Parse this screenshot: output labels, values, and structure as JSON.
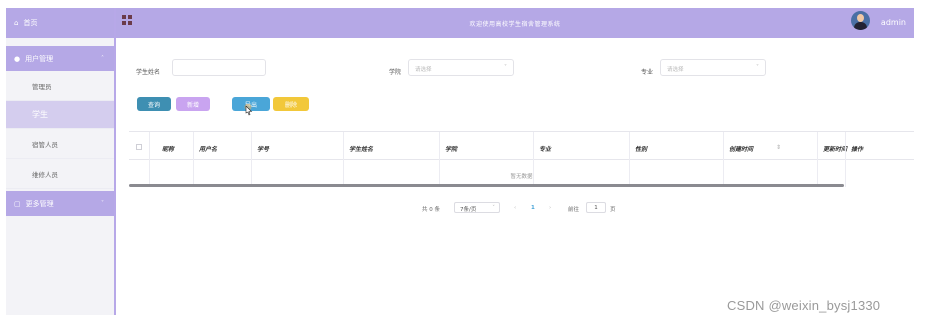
{
  "sidebar": {
    "home": "首页",
    "groups": [
      {
        "label": "用户管理",
        "items": [
          {
            "label": "管理员"
          },
          {
            "label": "学生"
          },
          {
            "label": "宿管人员"
          },
          {
            "label": "维修人员"
          }
        ]
      },
      {
        "label": "更多管理"
      }
    ]
  },
  "header": {
    "title": "欢迎使用高校学生宿舍管理系统",
    "user": "admin"
  },
  "search": {
    "student_name_label": "学生姓名",
    "college_label": "学院",
    "college_placeholder": "请选择",
    "major_label": "专业",
    "major_placeholder": "请选择"
  },
  "buttons": {
    "query": "查询",
    "add": "新增",
    "export": "导出",
    "delete": "删除"
  },
  "table": {
    "columns": [
      "昵称",
      "用户名",
      "学号",
      "学生姓名",
      "学院",
      "专业",
      "性别",
      "创建时间",
      "更新时间",
      "操作"
    ],
    "empty_text": "暂无数据"
  },
  "pagination": {
    "total": "共 0 条",
    "page_size": "7条/页",
    "current_page": "1",
    "goto_label": "前往",
    "goto_value": "1",
    "page_suffix": "页"
  },
  "watermark": "CSDN @weixin_bysj1330",
  "colors": {
    "sidebar_header": "#b5a8e6",
    "query_button": "#3e8fb2",
    "add_button": "#c9a4f0",
    "export_button": "#4aa6d8",
    "delete_button": "#f2c83a"
  }
}
